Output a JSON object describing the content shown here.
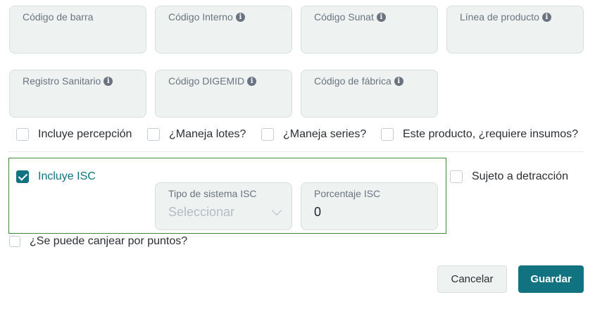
{
  "fields": {
    "codigo_barra": {
      "label": "Código de barra",
      "value": ""
    },
    "codigo_interno": {
      "label": "Código Interno",
      "value": ""
    },
    "codigo_sunat": {
      "label": "Código Sunat",
      "value": ""
    },
    "linea_producto": {
      "label": "Línea de producto",
      "value": ""
    },
    "registro_sanitario": {
      "label": "Registro Sanitario",
      "value": ""
    },
    "codigo_digemid": {
      "label": "Código DIGEMID",
      "value": ""
    },
    "codigo_fabrica": {
      "label": "Código de fábrica",
      "value": ""
    }
  },
  "info_icon_glyph": "i",
  "checkboxes": {
    "percepcion": {
      "label": "Incluye percepción",
      "checked": false
    },
    "lotes": {
      "label": "¿Maneja lotes?",
      "checked": false
    },
    "series": {
      "label": "¿Maneja series?",
      "checked": false
    },
    "insumos": {
      "label": "Este producto, ¿requiere insumos?",
      "checked": false
    },
    "isc": {
      "label": "Incluye ISC",
      "checked": true
    },
    "detraccion": {
      "label": "Sujeto a detracción",
      "checked": false
    },
    "puntos": {
      "label": "¿Se puede canjear por puntos?",
      "checked": false
    }
  },
  "isc": {
    "tipo_sistema": {
      "label": "Tipo de sistema ISC",
      "placeholder": "Seleccionar"
    },
    "porcentaje": {
      "label": "Porcentaje ISC",
      "value": "0"
    }
  },
  "actions": {
    "cancel_label": "Cancelar",
    "save_label": "Guardar"
  },
  "colors": {
    "accent": "#127380",
    "field_bg": "#eef3f2",
    "isc_border": "#3d8a3a"
  }
}
